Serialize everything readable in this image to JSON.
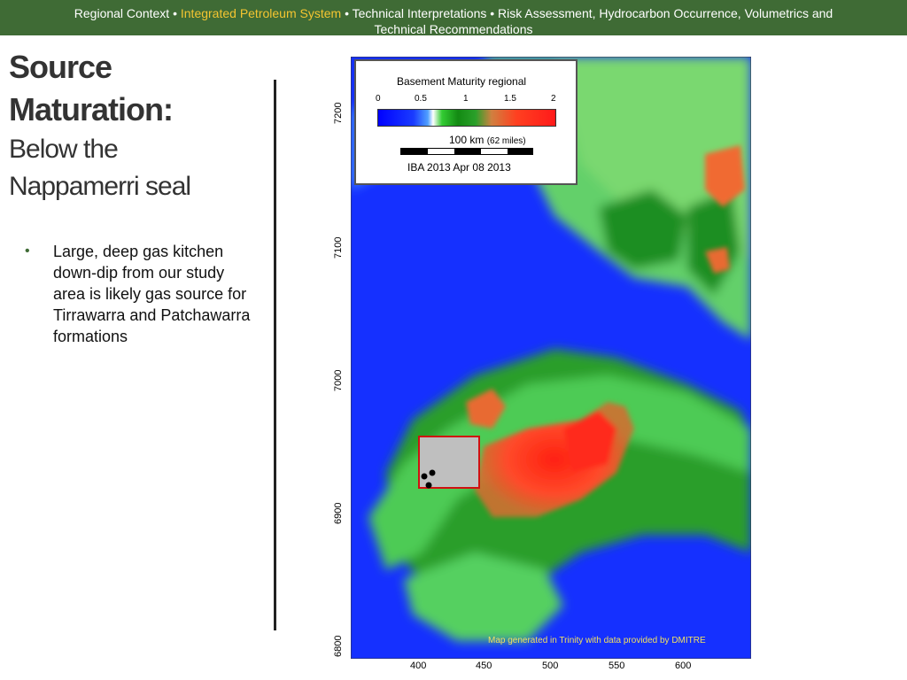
{
  "header": {
    "part1": "Regional Context • ",
    "part2": "Integrated Petroleum System",
    "part3": " • Technical Interpretations • Risk Assessment,  Hydrocarbon Occurrence, Volumetrics and",
    "line2": "Technical Recommendations"
  },
  "title": {
    "line1": "Source",
    "line2": "Maturation:",
    "line3": "Below the",
    "line4": "Nappamerri seal"
  },
  "bullets": [
    "Large, deep gas kitchen down-dip from our study area is likely gas source for Tirrawarra and Patchawarra formations"
  ],
  "map": {
    "legend_title": "Basement Maturity regional",
    "legend_ticks": [
      "0",
      "0.5",
      "1",
      "1.5",
      "2"
    ],
    "scale_text": "100 km",
    "scale_sub": "(62 miles)",
    "date_text": "IBA 2013 Apr 08 2013",
    "y_ticks": [
      "7200",
      "7100",
      "7000",
      "6900",
      "6800"
    ],
    "x_ticks": [
      "400",
      "450",
      "500",
      "550",
      "600"
    ],
    "credit": "Map generated in Trinity with data provided by DMITRE"
  },
  "colors": {
    "header_bg": "#3f6b35",
    "highlight": "#f4c531"
  }
}
